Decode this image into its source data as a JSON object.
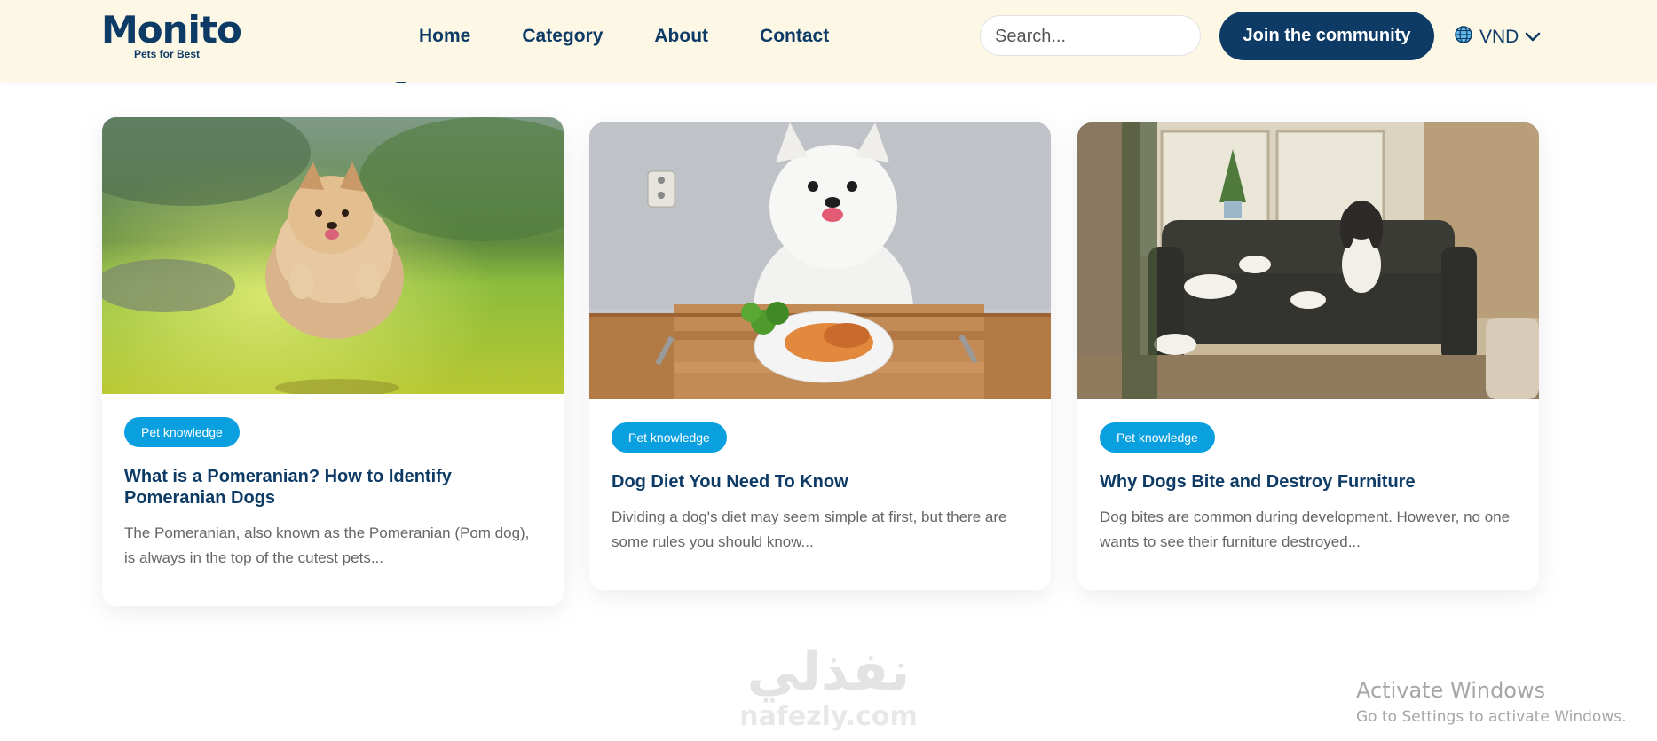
{
  "header": {
    "logo": {
      "name": "Monito",
      "tagline": "Pets for Best"
    },
    "nav": [
      {
        "label": "Home"
      },
      {
        "label": "Category"
      },
      {
        "label": "About"
      },
      {
        "label": "Contact"
      }
    ],
    "search": {
      "placeholder": "Search...",
      "value": ""
    },
    "cta_label": "Join the community",
    "currency": {
      "label": "VND",
      "icon": "globe-icon",
      "dropdown_icon": "chevron-down-icon"
    }
  },
  "section": {
    "title_fragment": "g"
  },
  "articles": [
    {
      "tag": "Pet knowledge",
      "title": "What is a Pomeranian? How to Identify Pomeranian Dogs",
      "excerpt": "The Pomeranian, also known as the Pomeranian (Pom dog), is always in the top of the cutest pets...",
      "image": "pomeranian running on grass"
    },
    {
      "tag": "Pet knowledge",
      "title": "Dog Diet You Need To Know",
      "excerpt": "Dividing a dog's diet may seem simple at first, but there are some rules you should know...",
      "image": "samoyed dog with plate of salmon and broccoli"
    },
    {
      "tag": "Pet knowledge",
      "title": "Why Dogs Bite and Destroy Furniture",
      "excerpt": "Dog bites are common during development. However, no one wants to see their furniture destroyed...",
      "image": "dog on a torn-up sofa"
    }
  ],
  "watermark": {
    "arabic": "نفذلي",
    "latin": "nafezly.com"
  },
  "os_notice": {
    "title": "Activate Windows",
    "subtitle": "Go to Settings to activate Windows."
  },
  "colors": {
    "brand": "#0d3b66",
    "accent": "#0aa0e0",
    "header_bg": "#fdf7e6"
  }
}
